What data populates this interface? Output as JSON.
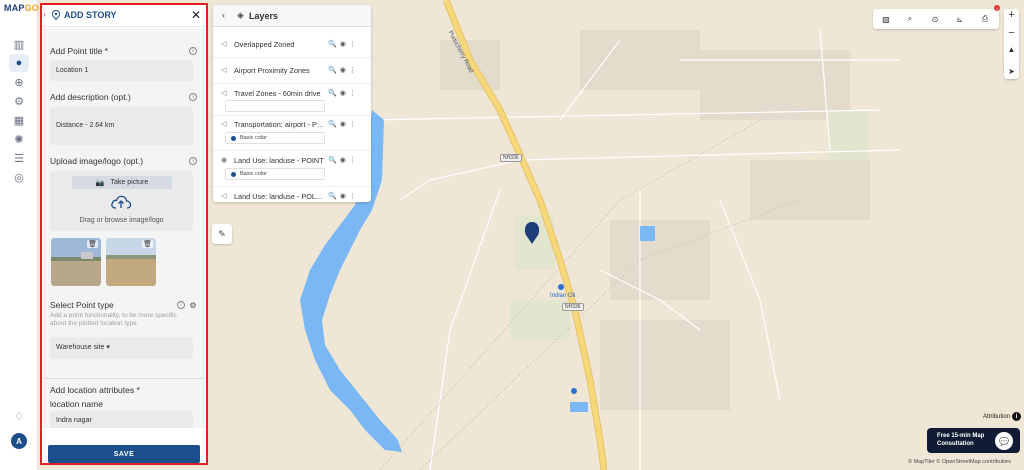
{
  "app": {
    "logo_main": "MAP",
    "logo_accent": "GO"
  },
  "rail": {
    "icons": [
      "map-icon",
      "location-pin-icon",
      "add-file-icon",
      "settings-icon",
      "gallery-icon",
      "cog-icon",
      "report-icon",
      "layers-world-icon"
    ],
    "avatar_letter": "A"
  },
  "story_panel": {
    "title": "ADD STORY",
    "point_title_label": "Add Point title *",
    "point_title_value": "Location 1",
    "description_label": "Add description (opt.)",
    "description_value": "Distance - 2.64 km",
    "upload_label": "Upload image/logo (opt.)",
    "take_picture": "Take picture",
    "drag_text": "Drag or browse image/logo",
    "point_type_label": "Select Point type",
    "point_type_hint": "Add a point functionality, to be more specific about the plotted location type",
    "point_type_value": "Warehouse site",
    "attributes_label": "Add location attributes *",
    "location_name_label": "location name",
    "location_name_value": "Indra nagar",
    "save_label": "SAVE"
  },
  "layers_panel": {
    "title": "Layers",
    "items": [
      {
        "name": "Overlapped Zoned",
        "icon": "polygon-icon"
      },
      {
        "name": "Airport Proximity Zones",
        "icon": "polygon-icon"
      },
      {
        "name": "Travel Zones - 60min drive",
        "icon": "polygon-icon"
      },
      {
        "name": "Transportation: airport - POINT",
        "icon": "polygon-icon",
        "legend": "Basic color"
      },
      {
        "name": "Land Use: landuse - POINT",
        "icon": "point-icon",
        "legend": "Basic color"
      },
      {
        "name": "Land Use: landuse - POLYGON",
        "icon": "polygon-icon"
      }
    ]
  },
  "map": {
    "road_label": "Puducherry Road",
    "shield_1": "NH336",
    "shield_2": "NH336",
    "poi_label": "Indian Oil",
    "water_color": "#7ab8f5",
    "road_color": "#f6d77a",
    "marker_color": "#1c3f7a"
  },
  "controls": {
    "attribution": "Attribution",
    "consult_line1": "Free 15-min Map",
    "consult_line2": "Consultation",
    "credit": "© MapTiler © OpenStreetMap contributors"
  }
}
